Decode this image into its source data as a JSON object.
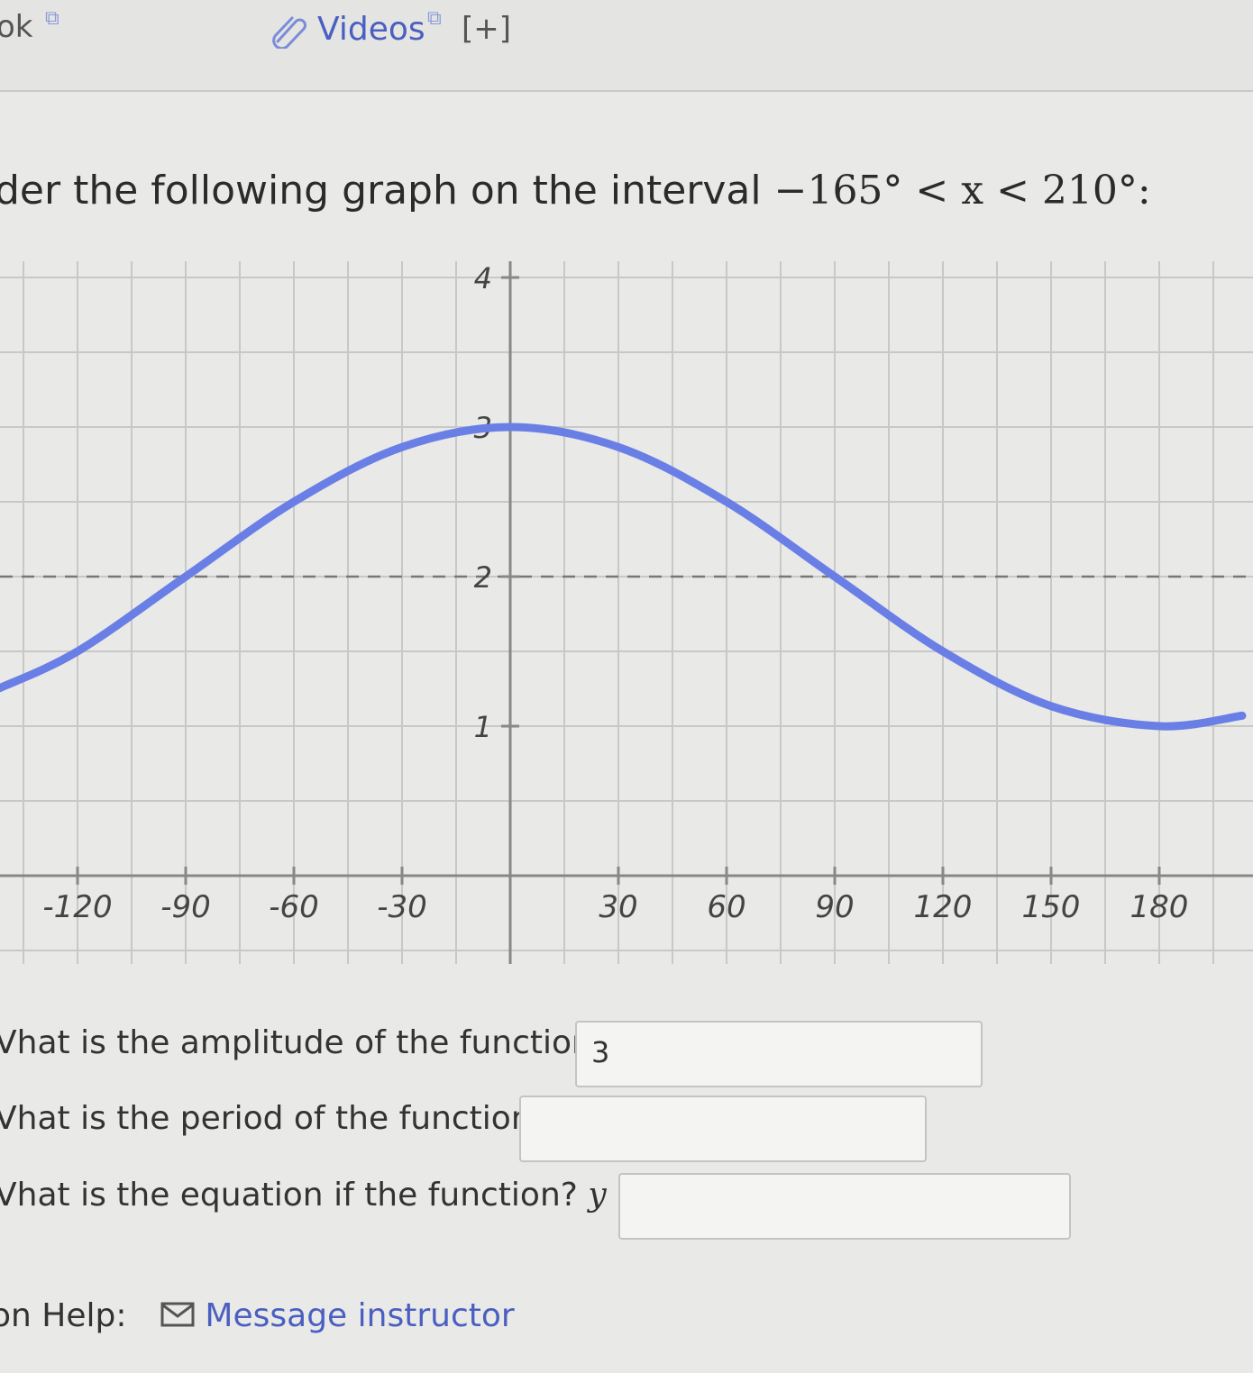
{
  "nav": {
    "ebook_label": "ok",
    "videos_label": "Videos",
    "expand_label": "[+]"
  },
  "question": {
    "prefix": "der the following graph on the interval ",
    "interval": "−165° < x < 210°:"
  },
  "chart_data": {
    "type": "line",
    "x_tick_labels": [
      "-120",
      "-90",
      "-60",
      "-30",
      "30",
      "60",
      "90",
      "120",
      "150",
      "180"
    ],
    "y_tick_labels": [
      "1",
      "2",
      "3",
      "4"
    ],
    "xlim": [
      -142,
      203
    ],
    "ylim": [
      0,
      4.2
    ],
    "midline_y": 2,
    "series": [
      {
        "x": [
          -142,
          -120,
          -90,
          -60,
          -30,
          0,
          30,
          60,
          90,
          120,
          150,
          180,
          203
        ],
        "y": [
          1.25,
          1.5,
          2.0,
          2.5,
          2.866,
          3.0,
          2.866,
          2.5,
          2.0,
          1.5,
          1.134,
          1.0,
          1.07
        ]
      }
    ],
    "colors": {
      "curve": "#6a7fe6",
      "grid": "#c8c8c8",
      "axis": "#888888"
    },
    "grid": true
  },
  "questions": [
    {
      "label": "Vhat is the amplitude of the function?",
      "value": "3"
    },
    {
      "label": "Vhat is the period of the function?",
      "value": ""
    },
    {
      "label": "Vhat is the equation if the function?",
      "var": "y =",
      "value": ""
    }
  ],
  "help": {
    "label": "on Help:",
    "message_link": "Message instructor"
  }
}
